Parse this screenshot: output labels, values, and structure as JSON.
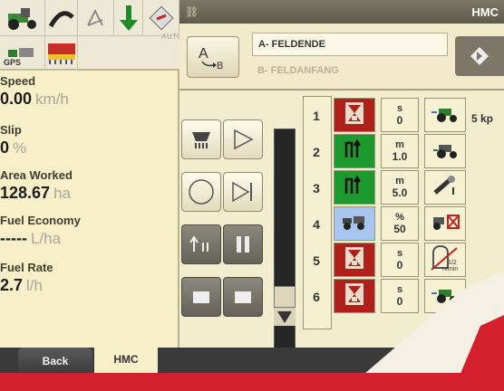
{
  "status_icons": {
    "gps_label": "GPS",
    "auto_label": "AUTO",
    "icons": [
      "tractor-icon",
      "hitch-icon",
      "auto-steer-icon",
      "down-arrow-icon",
      "implement-icon",
      "satellite-icon",
      "planter-icon"
    ]
  },
  "metrics": [
    {
      "label": "Speed",
      "value": "0.00",
      "unit": "km/h"
    },
    {
      "label": "Slip",
      "value": "0",
      "unit": "%"
    },
    {
      "label": "Area Worked",
      "value": "128.67",
      "unit": "ha"
    },
    {
      "label": "Fuel Economy",
      "value": "-----",
      "unit": "L/ha"
    },
    {
      "label": "Fuel Rate",
      "value": "2.7",
      "unit": "l/h"
    }
  ],
  "header": {
    "title": "HMC"
  },
  "sequence": {
    "a_label": "A- FELDENDE",
    "b_label": "B- FELDANFANG"
  },
  "rows": [
    {
      "num": "1",
      "func": "red",
      "unit": "s",
      "value": "0",
      "icon": "tractor-speed-icon",
      "note": "5 kp"
    },
    {
      "num": "2",
      "func": "green",
      "unit": "m",
      "value": "1.0",
      "icon": "tractor-rev-icon",
      "note": ""
    },
    {
      "num": "3",
      "func": "green",
      "unit": "m",
      "value": "5.0",
      "icon": "hitch-lift-icon",
      "note": ""
    },
    {
      "num": "4",
      "func": "blue",
      "unit": "%",
      "value": "50",
      "icon": "tractor-cancel-icon",
      "note": ""
    },
    {
      "num": "5",
      "func": "red",
      "unit": "s",
      "value": "0",
      "icon": "rpm-cancel-icon",
      "note": ""
    },
    {
      "num": "6",
      "func": "red",
      "unit": "s",
      "value": "0",
      "icon": "tractor-speed-icon",
      "note": ""
    }
  ],
  "rpm_label": "1/2\nn/min",
  "tabs": {
    "back": "Back",
    "hmc": "HMC"
  },
  "colors": {
    "panel_bg": "#f6efc8",
    "accent_red": "#d4202c",
    "func_red": "#b0201b",
    "func_green": "#1d9a2e",
    "func_blue": "#a8c5f0"
  }
}
